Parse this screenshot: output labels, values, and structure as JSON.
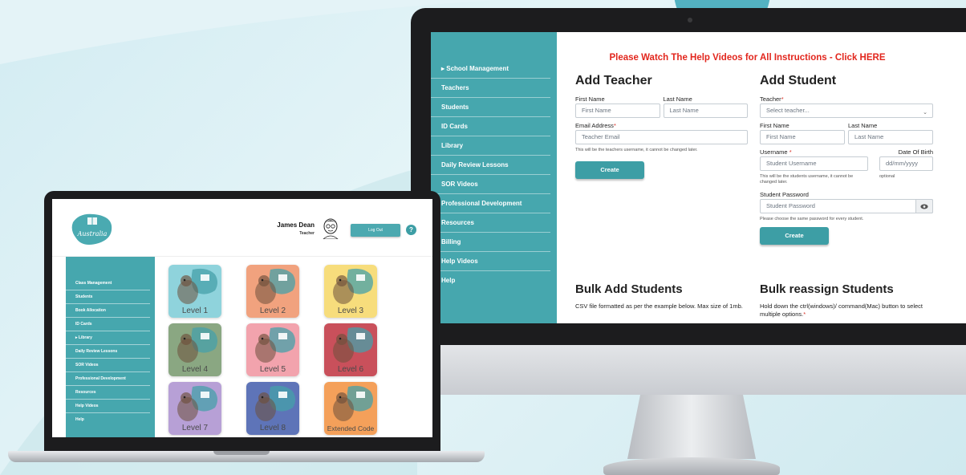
{
  "colors": {
    "teal": "#46a7ae",
    "teal_dark": "#3d9ea5",
    "alert_red": "#e2261d",
    "background": "#d3ecf2"
  },
  "desktop": {
    "sidebar": {
      "items": [
        {
          "label": "▸ School Management",
          "icon": "chevron-right-icon"
        },
        {
          "label": "Teachers"
        },
        {
          "label": "Students"
        },
        {
          "label": "ID Cards"
        },
        {
          "label": "Library"
        },
        {
          "label": "Daily Review Lessons"
        },
        {
          "label": "SOR Videos"
        },
        {
          "label": "Professional Development"
        },
        {
          "label": "Resources"
        },
        {
          "label": "Billing"
        },
        {
          "label": "Help Videos"
        },
        {
          "label": "Help"
        }
      ]
    },
    "banner": "Please Watch The Help Videos for All Instructions - Click HERE",
    "add_teacher": {
      "title": "Add Teacher",
      "first_name_label": "First Name",
      "first_name_placeholder": "First Name",
      "last_name_label": "Last Name",
      "last_name_placeholder": "Last Name",
      "email_label": "Email Address",
      "email_placeholder": "Teacher Email",
      "email_hint": "This will be the teachers username, it cannot be changed later.",
      "create_label": "Create"
    },
    "add_student": {
      "title": "Add Student",
      "teacher_label": "Teacher",
      "teacher_select": "Select teacher...",
      "first_name_label": "First Name",
      "first_name_placeholder": "First Name",
      "last_name_label": "Last Name",
      "last_name_placeholder": "Last Name",
      "username_label": "Username",
      "username_placeholder": "Student Username",
      "username_hint": "This will be the students username, it cannot be changed later.",
      "dob_label": "Date Of Birth",
      "dob_placeholder": "dd/mm/yyyy",
      "dob_hint": "optional",
      "password_label": "Student Password",
      "password_placeholder": "Student Password",
      "password_hint": "Please choose the same password for every student.",
      "create_label": "Create",
      "required_mark": "*"
    },
    "bulk_add": {
      "title": "Bulk Add Students",
      "text": "CSV file formatted as per the example below. Max size of 1mb."
    },
    "bulk_reassign": {
      "title": "Bulk reassign Students",
      "text": "Hold down the ctrl(windows)/ command(Mac) button to select multiple options.",
      "required_mark": "*"
    }
  },
  "laptop": {
    "logo_text": "Australia",
    "user": {
      "name": "James Dean",
      "role": "Teacher"
    },
    "logout_label": "Log Out",
    "help_label": "?",
    "sidebar": {
      "items": [
        {
          "label": "Class Management"
        },
        {
          "label": "Students"
        },
        {
          "label": "Book Allocation"
        },
        {
          "label": "ID Cards"
        },
        {
          "label": "▸ Library",
          "icon": "chevron-right-icon"
        },
        {
          "label": "Daily Review Lessons"
        },
        {
          "label": "SOR Videos"
        },
        {
          "label": "Professional Development"
        },
        {
          "label": "Resources"
        },
        {
          "label": "Help Videos"
        },
        {
          "label": "Help"
        }
      ]
    },
    "levels": [
      {
        "label": "Level 1",
        "color": "#8fd3dc",
        "animal": "kangaroo"
      },
      {
        "label": "Level 2",
        "color": "#f1a27e",
        "animal": "koala"
      },
      {
        "label": "Level 3",
        "color": "#f7dd7c",
        "animal": "wombat"
      },
      {
        "label": "Level 4",
        "color": "#8aa782",
        "animal": "lizard"
      },
      {
        "label": "Level 5",
        "color": "#f2a3ad",
        "animal": "dingo"
      },
      {
        "label": "Level 6",
        "color": "#c9505b",
        "animal": "echidna"
      },
      {
        "label": "Level 7",
        "color": "#b7a0d6",
        "animal": "quokka"
      },
      {
        "label": "Level 8",
        "color": "#5e74b8",
        "animal": "owl"
      },
      {
        "label": "Extended Code",
        "color": "#f4a05a",
        "animal": "cyclist"
      }
    ]
  }
}
